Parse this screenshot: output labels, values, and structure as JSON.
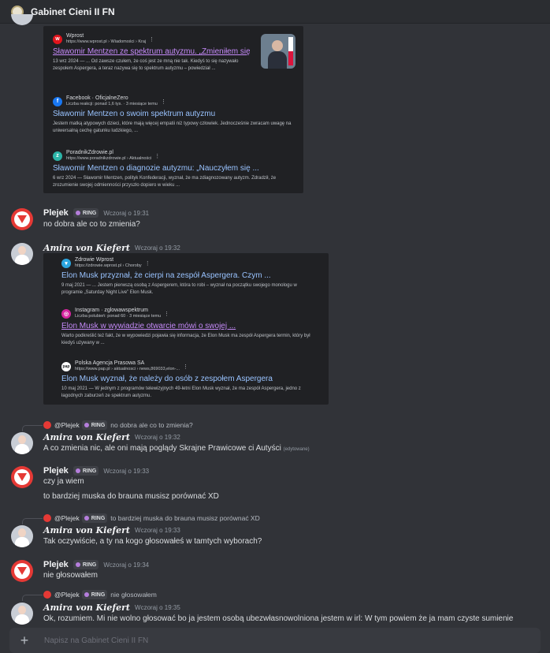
{
  "channel": {
    "title": "Gabinet Cieni II FN"
  },
  "search1": {
    "results": [
      {
        "source": "Wprost",
        "url": "https://www.wprost.pl › Wiadomości › Kraj",
        "title": "Sławomir Mentzen ze spektrum autyzmu. „Zmieniłem się i ...",
        "snippet": "13 wrz 2024 — ... Od zawsze czułem, że coś jest ze mną nie tak. Kiedyś to się nazywało zespołem Aspergera, a teraz nazywa się to spektrum autyzmu – powiedział ..."
      },
      {
        "source": "Facebook · OficjalneZero",
        "url": "Liczba reakcji: ponad 1,6 tys. · 3 miesiące temu",
        "title": "Sławomir Mentzen o swoim spektrum autyzmu",
        "snippet": "Jestem matką atypowych dzieci, które mają więcej empatii niż typowy człowiek. Jednocześnie zwracam uwagę na uniwersalną cechę gatunku ludzkiego, ..."
      },
      {
        "source": "PoradnikZdrowie.pl",
        "url": "https://www.poradnikzdrowie.pl › Aktualności",
        "title": "Sławomir Mentzen o diagnozie autyzmu: „Nauczyłem się ...",
        "snippet": "6 wrz 2024 — Sławomir Mentzen, polityk Konfederacji, wyznał, że ma zdiagnozowany autyzm. Zdradził, że zrozumienie swojej odmienności przyszło dopiero w wieku ..."
      }
    ]
  },
  "messages": {
    "m1": {
      "author": "Plejek",
      "tag": "RING",
      "time": "Wczoraj o 19:31",
      "text": "no dobra ale co to zmienia?"
    },
    "m2": {
      "author": "Amira von Kiefert",
      "time": "Wczoraj o 19:32"
    },
    "m3": {
      "reply_author": "@Plejek",
      "reply_tag": "RING",
      "reply_text": "no dobra ale co to zmienia?",
      "author": "Amira von Kiefert",
      "time": "Wczoraj o 19:32",
      "text": "A co zmienia nic, ale oni mają poglądy Skrajne Prawicowe ci Autyści",
      "edited": "(edytowane)"
    },
    "m4": {
      "author": "Plejek",
      "tag": "RING",
      "time": "Wczoraj o 19:33",
      "text1": "czy ja wiem",
      "text2": "to bardziej muska do brauna musisz porównać XD"
    },
    "m5": {
      "reply_author": "@Plejek",
      "reply_tag": "RING",
      "reply_text": "to bardziej muska do brauna musisz porównać XD",
      "author": "Amira von Kiefert",
      "time": "Wczoraj o 19:33",
      "text": "Tak oczywiście, a ty na kogo głosowałeś w tamtych wyborach?"
    },
    "m6": {
      "author": "Plejek",
      "tag": "RING",
      "time": "Wczoraj o 19:34",
      "text": "nie głosowałem"
    },
    "m7": {
      "reply_author": "@Plejek",
      "reply_tag": "RING",
      "reply_text": "nie głosowałem",
      "author": "Amira von Kiefert",
      "time": "Wczoraj o 19:35",
      "text": "Ok, rozumiem. Mi nie wolno głosować bo ja jestem osobą ubezwłasnowolniona jestem w irl: W tym powiem że ja mam czyste sumienie"
    }
  },
  "search2": {
    "results": [
      {
        "source": "Zdrowie Wprost",
        "url": "https://zdrowie.wprost.pl › Choroby",
        "title": "Elon Musk przyznał, że cierpi na zespół Aspergera. Czym ...",
        "snippet": "9 maj 2021 — ... Jestem pierwszą osobą z Aspergerem, która to robi – wyznał na początku swojego monologu w programie „Saturday Night Live” Elon Musk."
      },
      {
        "source": "Instagram · zglowawspektrum",
        "url": "Liczba polubień: ponad 60 · 3 miesiące temu",
        "title": "Elon Musk w wywiadzie otwarcie mówi o swojej ...",
        "snippet": "Warto podkreślić też fakt, że w wypowiedzi pojawia się informacja, że Elon Musk ma zespół Aspergera termin, który był kiedyś używany w ..."
      },
      {
        "source": "Polska Agencja Prasowa SA",
        "url": "https://www.pap.pl › aktualnosci › news,869033,elon-...",
        "title": "Elon Musk wyznał, że należy do osób z zespołem Aspergera",
        "snippet": "10 maj 2021 — W jednym z programów telewizyjnych 49-letni Elon Musk wyznał, że ma zespół Aspergera, jedno z łagodnych zaburzeń ze spektrum autyzmu."
      }
    ]
  },
  "composer": {
    "placeholder": "Napisz na Gabinet Cieni II FN"
  },
  "icons": {
    "add": "plus-icon",
    "more": "vertical-dots-icon"
  },
  "colors": {
    "bg": "#313338",
    "link": "#99c3ff",
    "visited": "#c58af9",
    "plejek_avatar": "#e53935",
    "ring_dot": "#b57edc"
  }
}
